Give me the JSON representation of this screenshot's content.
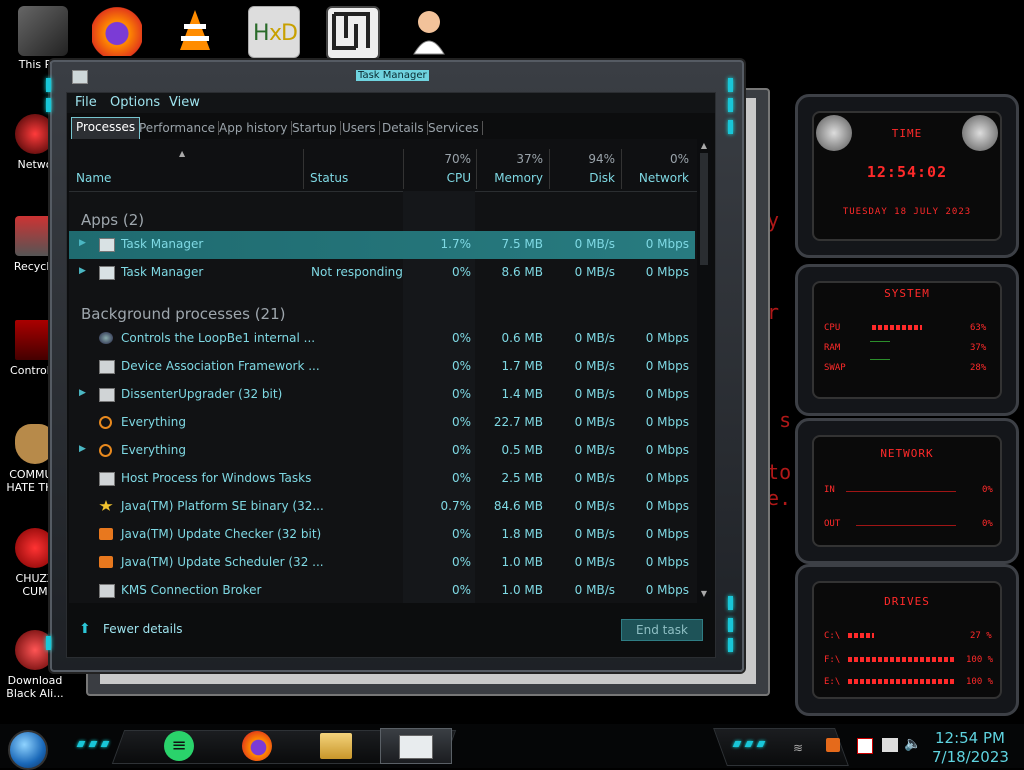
{
  "desktop": {
    "top_icons": [
      "thispc-icon",
      "firefox-icon",
      "vlc-icon",
      "hxd-icon",
      "app-icon",
      "user-icon"
    ],
    "left_icons": [
      {
        "label": "This P"
      },
      {
        "label": "Netwo"
      },
      {
        "label": "Recycle"
      },
      {
        "label": "Control P"
      },
      {
        "label": "COMMUN HATE THIS"
      },
      {
        "label": "CHUZZ CUM"
      },
      {
        "label": "Download Black Ali..."
      }
    ],
    "bg_text": [
      "ry",
      "ryp",
      "or",
      "t s",
      "oto",
      "ne."
    ]
  },
  "window": {
    "title": "Task Manager",
    "menu": [
      "File",
      "Options",
      "View"
    ],
    "tabs": [
      "Processes",
      "Performance",
      "App history",
      "Startup",
      "Users",
      "Details",
      "Services"
    ],
    "headers": {
      "name": "Name",
      "status": "Status",
      "cpu_pct": "70%",
      "cpu": "CPU",
      "mem_pct": "37%",
      "mem": "Memory",
      "disk_pct": "94%",
      "disk": "Disk",
      "net_pct": "0%",
      "net": "Network"
    },
    "groups": {
      "apps": "Apps (2)",
      "background": "Background processes (21)"
    },
    "rows": [
      {
        "name": "Task Manager",
        "status": "",
        "cpu": "1.7%",
        "mem": "7.5 MB",
        "disk": "0 MB/s",
        "net": "0 Mbps",
        "icon": "taskmanager-icon",
        "selected": true,
        "expand": true
      },
      {
        "name": "Task Manager",
        "status": "Not responding",
        "cpu": "0%",
        "mem": "8.6 MB",
        "disk": "0 MB/s",
        "net": "0 Mbps",
        "icon": "taskmanager-icon",
        "expand": true
      },
      {
        "name": "Controls the LoopBe1 internal ...",
        "status": "",
        "cpu": "0%",
        "mem": "0.6 MB",
        "disk": "0 MB/s",
        "net": "0 Mbps",
        "icon": "loopbe-icon"
      },
      {
        "name": "Device Association Framework ...",
        "status": "",
        "cpu": "0%",
        "mem": "1.7 MB",
        "disk": "0 MB/s",
        "net": "0 Mbps",
        "icon": "window-icon"
      },
      {
        "name": "DissenterUpgrader (32 bit)",
        "status": "",
        "cpu": "0%",
        "mem": "1.4 MB",
        "disk": "0 MB/s",
        "net": "0 Mbps",
        "icon": "window-icon",
        "expand": true
      },
      {
        "name": "Everything",
        "status": "",
        "cpu": "0%",
        "mem": "22.7 MB",
        "disk": "0 MB/s",
        "net": "0 Mbps",
        "icon": "magnifier-icon"
      },
      {
        "name": "Everything",
        "status": "",
        "cpu": "0%",
        "mem": "0.5 MB",
        "disk": "0 MB/s",
        "net": "0 Mbps",
        "icon": "magnifier-icon",
        "expand": true
      },
      {
        "name": "Host Process for Windows Tasks",
        "status": "",
        "cpu": "0%",
        "mem": "2.5 MB",
        "disk": "0 MB/s",
        "net": "0 Mbps",
        "icon": "window-icon"
      },
      {
        "name": "Java(TM) Platform SE binary (32...",
        "status": "",
        "cpu": "0.7%",
        "mem": "84.6 MB",
        "disk": "0 MB/s",
        "net": "0 Mbps",
        "icon": "java-icon"
      },
      {
        "name": "Java(TM) Update Checker (32 bit)",
        "status": "",
        "cpu": "0%",
        "mem": "1.8 MB",
        "disk": "0 MB/s",
        "net": "0 Mbps",
        "icon": "java-update-icon"
      },
      {
        "name": "Java(TM) Update Scheduler (32 ...",
        "status": "",
        "cpu": "0%",
        "mem": "1.0 MB",
        "disk": "0 MB/s",
        "net": "0 Mbps",
        "icon": "java-update-icon"
      },
      {
        "name": "KMS Connection Broker",
        "status": "",
        "cpu": "0%",
        "mem": "1.0 MB",
        "disk": "0 MB/s",
        "net": "0 Mbps",
        "icon": "window-icon"
      }
    ],
    "fewer_details": "Fewer details",
    "end_task": "End task"
  },
  "widgets": {
    "time": {
      "title": "TIME",
      "clock": "12:54:02",
      "date": "TUESDAY 18 JULY 2023"
    },
    "system": {
      "title": "SYSTEM",
      "rows": [
        {
          "label": "CPU",
          "value": "63%"
        },
        {
          "label": "RAM",
          "value": "37%"
        },
        {
          "label": "SWAP",
          "value": "28%"
        }
      ]
    },
    "network": {
      "title": "NETWORK",
      "rows": [
        {
          "label": "IN",
          "value": "0%"
        },
        {
          "label": "OUT",
          "value": "0%"
        }
      ]
    },
    "drives": {
      "title": "DRIVES",
      "rows": [
        {
          "label": "C:\\",
          "value": "27 %"
        },
        {
          "label": "F:\\",
          "value": "100 %"
        },
        {
          "label": "E:\\",
          "value": "100 %"
        }
      ]
    }
  },
  "taskbar": {
    "time": "12:54 PM",
    "date": "7/18/2023",
    "apps": [
      "start-orb-icon",
      "messaging-app-icon",
      "firefox-icon",
      "file-explorer-icon",
      "task-manager-icon"
    ]
  },
  "colors": {
    "accent": "#19c6d8",
    "selected_row": "#287b80",
    "widget_red": "#ff2a2a"
  }
}
